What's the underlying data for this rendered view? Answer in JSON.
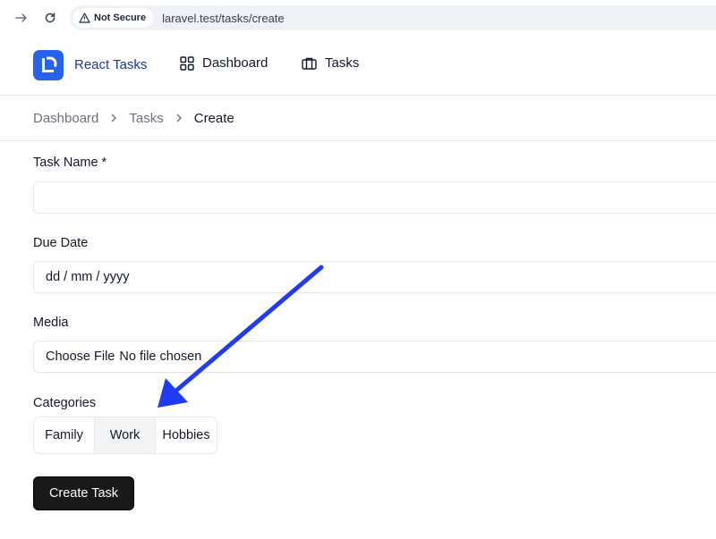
{
  "browser": {
    "security_label": "Not Secure",
    "url": "laravel.test/tasks/create"
  },
  "app": {
    "brand": "React Tasks",
    "nav": [
      {
        "label": "Dashboard",
        "icon": "grid-icon"
      },
      {
        "label": "Tasks",
        "icon": "briefcase-icon"
      }
    ]
  },
  "breadcrumb": [
    "Dashboard",
    "Create"
  ],
  "breadcrumb_middle": "Tasks",
  "form": {
    "task_name_label": "Task Name *",
    "task_name_value": "",
    "due_date_label": "Due Date",
    "due_date_placeholder": "dd / mm / yyyy",
    "media_label": "Media",
    "file_button": "Choose File",
    "file_status": "No file chosen",
    "categories_label": "Categories",
    "categories": [
      "Family",
      "Work",
      "Hobbies"
    ],
    "selected_category": "Work",
    "submit": "Create Task"
  },
  "colors": {
    "brand": "#2563eb",
    "annotation_arrow": "#1f3bf5",
    "submit_bg": "#18181b"
  }
}
